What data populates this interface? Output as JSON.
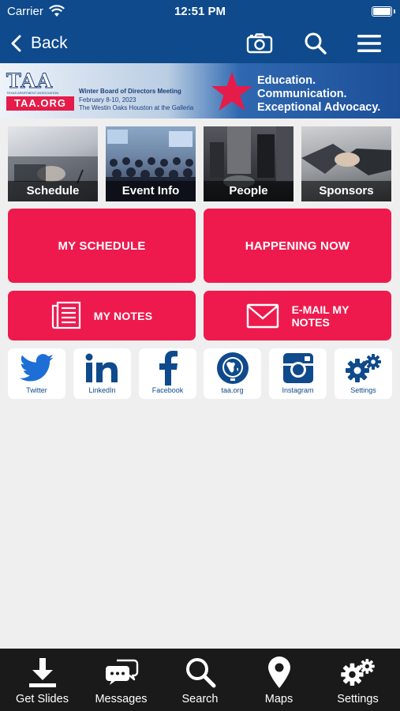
{
  "status_bar": {
    "carrier": "Carrier",
    "time": "12:51 PM"
  },
  "nav": {
    "back_label": "Back",
    "icons": [
      "camera-icon",
      "search-icon",
      "hamburger-menu-icon"
    ]
  },
  "banner": {
    "logo_text": "TAA",
    "logo_small": "TEXAS APARTMENT ASSOCIATION",
    "logo_url": "TAA.ORG",
    "event_title": "Winter Board of Directors Meeting",
    "event_dates": "February 8-10, 2023",
    "event_venue": "The Westin Oaks Houston at the Galleria",
    "tagline": [
      "Education.",
      "Communication.",
      "Exceptional Advocacy."
    ]
  },
  "tiles": [
    {
      "label": "Schedule"
    },
    {
      "label": "Event Info"
    },
    {
      "label": "People"
    },
    {
      "label": "Sponsors"
    }
  ],
  "buttons": {
    "my_schedule": "MY SCHEDULE",
    "happening_now": "HAPPENING NOW",
    "my_notes": "MY NOTES",
    "email_notes_1": "E-MAIL MY",
    "email_notes_2": "NOTES"
  },
  "social": [
    {
      "label": "Twitter",
      "icon": "twitter-icon"
    },
    {
      "label": "LinkedIn",
      "icon": "linkedin-icon"
    },
    {
      "label": "Facebook",
      "icon": "facebook-icon"
    },
    {
      "label": "taa.org",
      "icon": "globe-icon"
    },
    {
      "label": "Instagram",
      "icon": "instagram-icon"
    },
    {
      "label": "Settings",
      "icon": "gears-icon"
    }
  ],
  "tabbar": [
    {
      "label": "Get Slides",
      "icon": "download-icon"
    },
    {
      "label": "Messages",
      "icon": "messages-icon"
    },
    {
      "label": "Search",
      "icon": "search-icon"
    },
    {
      "label": "Maps",
      "icon": "map-pin-icon"
    },
    {
      "label": "Settings",
      "icon": "gears-icon"
    }
  ],
  "colors": {
    "nav_blue": "#0e4a8c",
    "accent_red": "#ee1a4e",
    "tabbar_bg": "#1a1a1a",
    "page_bg": "#efefef"
  }
}
